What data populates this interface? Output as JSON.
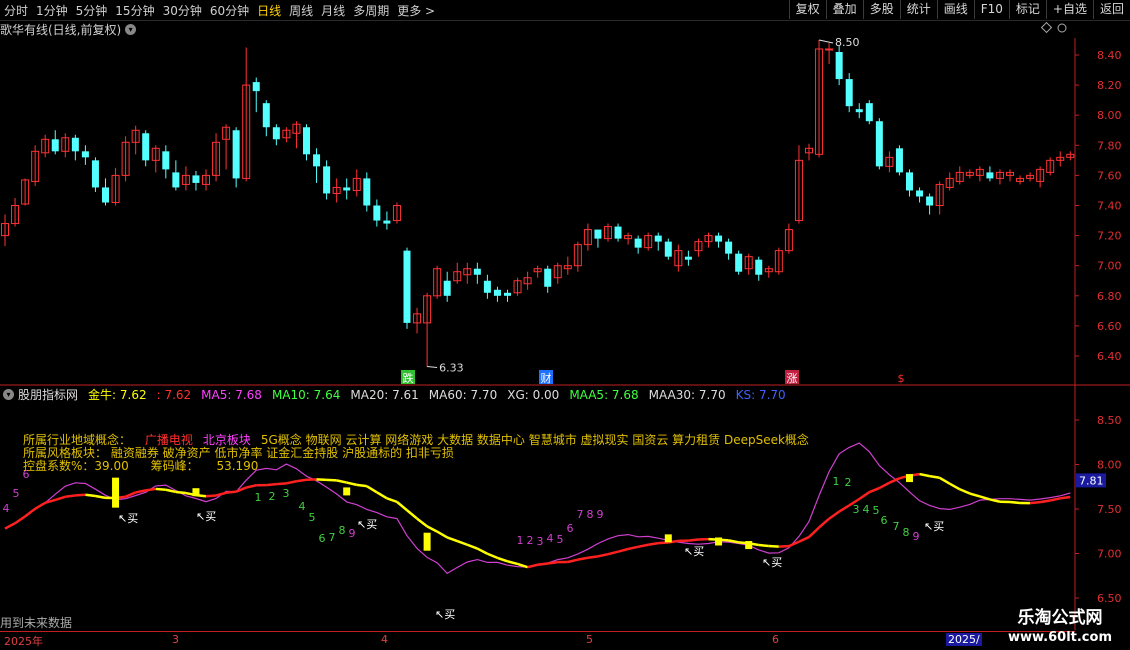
{
  "topbar": {
    "timeframes": [
      "分时",
      "1分钟",
      "5分钟",
      "15分钟",
      "30分钟",
      "60分钟",
      "日线",
      "周线",
      "月线",
      "多周期",
      "更多 >"
    ],
    "active": "日线",
    "right_buttons": [
      "复权",
      "叠加",
      "多股",
      "统计",
      "画线",
      "F10",
      "标记",
      "+自选",
      "返回"
    ]
  },
  "main_header": {
    "title": "歌华有线(日线,前复权)"
  },
  "price_axis": [
    "8.40",
    "8.20",
    "8.00",
    "7.80",
    "7.60",
    "7.40",
    "7.20",
    "7.00",
    "6.80",
    "6.60",
    "6.40"
  ],
  "annotations": {
    "high": "8.50",
    "low": "6.33"
  },
  "event_markers": [
    "跌",
    "财",
    "涨",
    "$"
  ],
  "indicator_header": {
    "name": "股朋指标网",
    "items": [
      {
        "label": "金牛: 7.62",
        "color": "#ffff00"
      },
      {
        "label": ": 7.62",
        "color": "#ff3030"
      },
      {
        "label": "MA5: 7.68",
        "color": "#ff40ff"
      },
      {
        "label": "MA10: 7.64",
        "color": "#40ff40"
      },
      {
        "label": "MA20: 7.61",
        "color": "#dddddd"
      },
      {
        "label": "MA60: 7.70",
        "color": "#dddddd"
      },
      {
        "label": "XG: 0.00",
        "color": "#dddddd"
      },
      {
        "label": "MAA5: 7.68",
        "color": "#40ff40"
      },
      {
        "label": "MAA30: 7.70",
        "color": "#dddddd"
      },
      {
        "label": "KS: 7.70",
        "color": "#4060ff"
      }
    ]
  },
  "concepts": {
    "line1_label": "所属行业地域概念：",
    "line1_items": [
      {
        "t": "广播电视",
        "c": "#ff3030"
      },
      {
        "t": "北京板块",
        "c": "#ff40ff"
      },
      {
        "t": "5G概念 物联网 云计算 网络游戏 大数据 数据中心 智慧城市 虚拟现实 国资云 算力租赁 DeepSeek概念",
        "c": "#e0c000"
      }
    ],
    "line2_label": "所属风格板块：",
    "line2_value": "融资融券 破净资产 低市净率 证金汇金持股 沪股通标的 扣非亏损",
    "line3": "控盘系数%：39.00",
    "line3b": "筹码峰：",
    "line3c": "53.190"
  },
  "ind_axis": [
    "8.50",
    "8.00",
    "7.50",
    "7.00",
    "6.50"
  ],
  "ind_current": "7.81",
  "buy_label": "↖买",
  "future_data": "用到未来数据",
  "dates": [
    "2025年",
    "3",
    "4",
    "5",
    "6",
    "2025/"
  ],
  "watermark": {
    "line1": "乐淘公式网",
    "line2": "www.60lt.com"
  },
  "colors": {
    "up": "#ff3232",
    "down": "#54ffff",
    "yellow": "#ffff00",
    "red": "#ff2020",
    "magenta": "#d040d0"
  },
  "candles": [
    [
      7.2,
      7.28,
      7.13,
      7.34
    ],
    [
      7.28,
      7.4,
      7.26,
      7.45
    ],
    [
      7.41,
      7.57,
      7.4,
      7.58
    ],
    [
      7.56,
      7.76,
      7.53,
      7.8
    ],
    [
      7.75,
      7.84,
      7.72,
      7.87
    ],
    [
      7.84,
      7.76,
      7.74,
      7.9
    ],
    [
      7.76,
      7.85,
      7.72,
      7.88
    ],
    [
      7.85,
      7.76,
      7.7,
      7.87
    ],
    [
      7.76,
      7.72,
      7.67,
      7.8
    ],
    [
      7.7,
      7.52,
      7.49,
      7.72
    ],
    [
      7.52,
      7.42,
      7.4,
      7.58
    ],
    [
      7.42,
      7.6,
      7.4,
      7.65
    ],
    [
      7.6,
      7.82,
      7.56,
      7.86
    ],
    [
      7.82,
      7.9,
      7.74,
      7.93
    ],
    [
      7.88,
      7.7,
      7.66,
      7.9
    ],
    [
      7.7,
      7.78,
      7.62,
      7.8
    ],
    [
      7.76,
      7.64,
      7.58,
      7.8
    ],
    [
      7.62,
      7.52,
      7.5,
      7.7
    ],
    [
      7.54,
      7.6,
      7.5,
      7.66
    ],
    [
      7.6,
      7.55,
      7.5,
      7.63
    ],
    [
      7.54,
      7.6,
      7.5,
      7.64
    ],
    [
      7.6,
      7.82,
      7.56,
      7.88
    ],
    [
      7.84,
      7.92,
      7.64,
      7.94
    ],
    [
      7.9,
      7.58,
      7.52,
      7.92
    ],
    [
      7.58,
      8.2,
      7.56,
      8.45
    ],
    [
      8.22,
      8.16,
      8.02,
      8.25
    ],
    [
      8.08,
      7.92,
      7.86,
      8.1
    ],
    [
      7.92,
      7.84,
      7.8,
      7.94
    ],
    [
      7.85,
      7.9,
      7.82,
      7.92
    ],
    [
      7.88,
      7.94,
      7.78,
      7.96
    ],
    [
      7.92,
      7.74,
      7.7,
      7.94
    ],
    [
      7.74,
      7.66,
      7.55,
      7.78
    ],
    [
      7.66,
      7.48,
      7.44,
      7.7
    ],
    [
      7.48,
      7.52,
      7.42,
      7.58
    ],
    [
      7.52,
      7.5,
      7.44,
      7.58
    ],
    [
      7.5,
      7.58,
      7.46,
      7.64
    ],
    [
      7.58,
      7.4,
      7.36,
      7.62
    ],
    [
      7.4,
      7.3,
      7.26,
      7.44
    ],
    [
      7.3,
      7.28,
      7.24,
      7.36
    ],
    [
      7.3,
      7.4,
      7.28,
      7.42
    ],
    [
      7.1,
      6.62,
      6.58,
      7.12
    ],
    [
      6.62,
      6.68,
      6.55,
      6.72
    ],
    [
      6.62,
      6.8,
      6.33,
      6.82
    ],
    [
      6.8,
      6.98,
      6.78,
      7.0
    ],
    [
      6.9,
      6.8,
      6.76,
      6.96
    ],
    [
      6.9,
      6.96,
      6.88,
      7.02
    ],
    [
      6.94,
      6.98,
      6.88,
      7.02
    ],
    [
      6.98,
      6.94,
      6.88,
      7.02
    ],
    [
      6.9,
      6.82,
      6.78,
      6.94
    ],
    [
      6.84,
      6.8,
      6.76,
      6.86
    ],
    [
      6.82,
      6.8,
      6.76,
      6.84
    ],
    [
      6.82,
      6.9,
      6.8,
      6.92
    ],
    [
      6.88,
      6.92,
      6.84,
      6.96
    ],
    [
      6.96,
      6.98,
      6.92,
      7.0
    ],
    [
      6.98,
      6.86,
      6.82,
      7.0
    ],
    [
      6.92,
      7.0,
      6.88,
      7.02
    ],
    [
      6.98,
      7.0,
      6.94,
      7.06
    ],
    [
      7.0,
      7.14,
      6.96,
      7.16
    ],
    [
      7.14,
      7.24,
      7.1,
      7.28
    ],
    [
      7.24,
      7.18,
      7.12,
      7.24
    ],
    [
      7.18,
      7.26,
      7.16,
      7.28
    ],
    [
      7.26,
      7.18,
      7.16,
      7.28
    ],
    [
      7.18,
      7.2,
      7.14,
      7.22
    ],
    [
      7.18,
      7.12,
      7.08,
      7.2
    ],
    [
      7.12,
      7.2,
      7.1,
      7.22
    ],
    [
      7.2,
      7.16,
      7.1,
      7.22
    ],
    [
      7.16,
      7.06,
      7.04,
      7.18
    ],
    [
      7.0,
      7.1,
      6.96,
      7.14
    ],
    [
      7.06,
      7.04,
      7.0,
      7.1
    ],
    [
      7.1,
      7.16,
      7.06,
      7.18
    ],
    [
      7.16,
      7.2,
      7.12,
      7.22
    ],
    [
      7.2,
      7.16,
      7.12,
      7.22
    ],
    [
      7.16,
      7.08,
      7.04,
      7.18
    ],
    [
      7.08,
      6.96,
      6.94,
      7.1
    ],
    [
      6.98,
      7.06,
      6.94,
      7.08
    ],
    [
      7.04,
      6.94,
      6.9,
      7.06
    ],
    [
      6.96,
      6.98,
      6.92,
      7.0
    ],
    [
      6.96,
      7.1,
      6.94,
      7.12
    ],
    [
      7.1,
      7.24,
      7.08,
      7.28
    ],
    [
      7.3,
      7.7,
      7.28,
      7.8
    ],
    [
      7.75,
      7.78,
      7.7,
      7.81
    ],
    [
      7.74,
      8.44,
      7.72,
      8.5
    ],
    [
      8.44,
      8.44,
      8.34,
      8.48
    ],
    [
      8.42,
      8.24,
      8.2,
      8.46
    ],
    [
      8.24,
      8.06,
      8.02,
      8.28
    ],
    [
      8.04,
      8.02,
      7.98,
      8.08
    ],
    [
      8.08,
      7.96,
      7.94,
      8.1
    ],
    [
      7.96,
      7.66,
      7.64,
      7.98
    ],
    [
      7.66,
      7.72,
      7.62,
      7.76
    ],
    [
      7.78,
      7.62,
      7.6,
      7.8
    ],
    [
      7.62,
      7.5,
      7.46,
      7.64
    ],
    [
      7.5,
      7.46,
      7.42,
      7.52
    ],
    [
      7.46,
      7.4,
      7.34,
      7.48
    ],
    [
      7.4,
      7.54,
      7.34,
      7.56
    ],
    [
      7.52,
      7.58,
      7.5,
      7.62
    ],
    [
      7.56,
      7.62,
      7.54,
      7.66
    ],
    [
      7.6,
      7.62,
      7.58,
      7.64
    ],
    [
      7.6,
      7.64,
      7.56,
      7.66
    ],
    [
      7.62,
      7.58,
      7.56,
      7.66
    ],
    [
      7.58,
      7.62,
      7.54,
      7.64
    ],
    [
      7.6,
      7.62,
      7.56,
      7.64
    ],
    [
      7.56,
      7.58,
      7.54,
      7.6
    ],
    [
      7.58,
      7.6,
      7.56,
      7.62
    ],
    [
      7.56,
      7.64,
      7.52,
      7.66
    ],
    [
      7.62,
      7.7,
      7.6,
      7.72
    ],
    [
      7.7,
      7.72,
      7.66,
      7.76
    ],
    [
      7.72,
      7.74,
      7.7,
      7.76
    ]
  ]
}
